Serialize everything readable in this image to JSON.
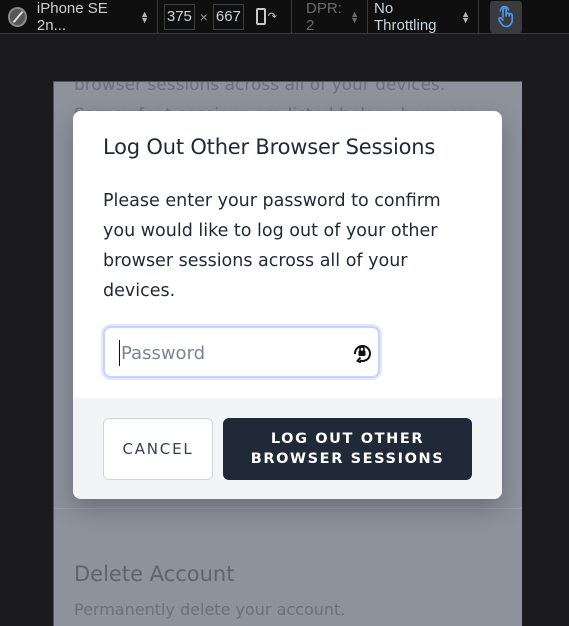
{
  "devtools": {
    "device_name": "iPhone SE 2n...",
    "width": "375",
    "times": "×",
    "height": "667",
    "dpr": "DPR: 2",
    "throttling": "No Throttling",
    "icons": {
      "device_compass": "compass-icon",
      "rotate": "rotate-device-icon",
      "touch": "touch-hand-icon"
    },
    "accent_color": "#4c9bf0"
  },
  "page_background": {
    "line1": "browser sessions across all of your devices. Some of",
    "line2": "your recent sessions are listed below; however, this",
    "delete_heading": "Delete Account",
    "delete_sub": "Permanently delete your account."
  },
  "modal": {
    "title": "Log Out Other Browser Sessions",
    "body": "Please enter your password to confirm you would like to log out of your other browser sessions across all of your devices.",
    "password": {
      "value": "",
      "placeholder": "Password",
      "icon": "password-manager-icon"
    },
    "cancel_label": "CANCEL",
    "confirm_label": "LOG OUT OTHER BROWSER SESSIONS",
    "confirm_color": "#1f2937"
  }
}
